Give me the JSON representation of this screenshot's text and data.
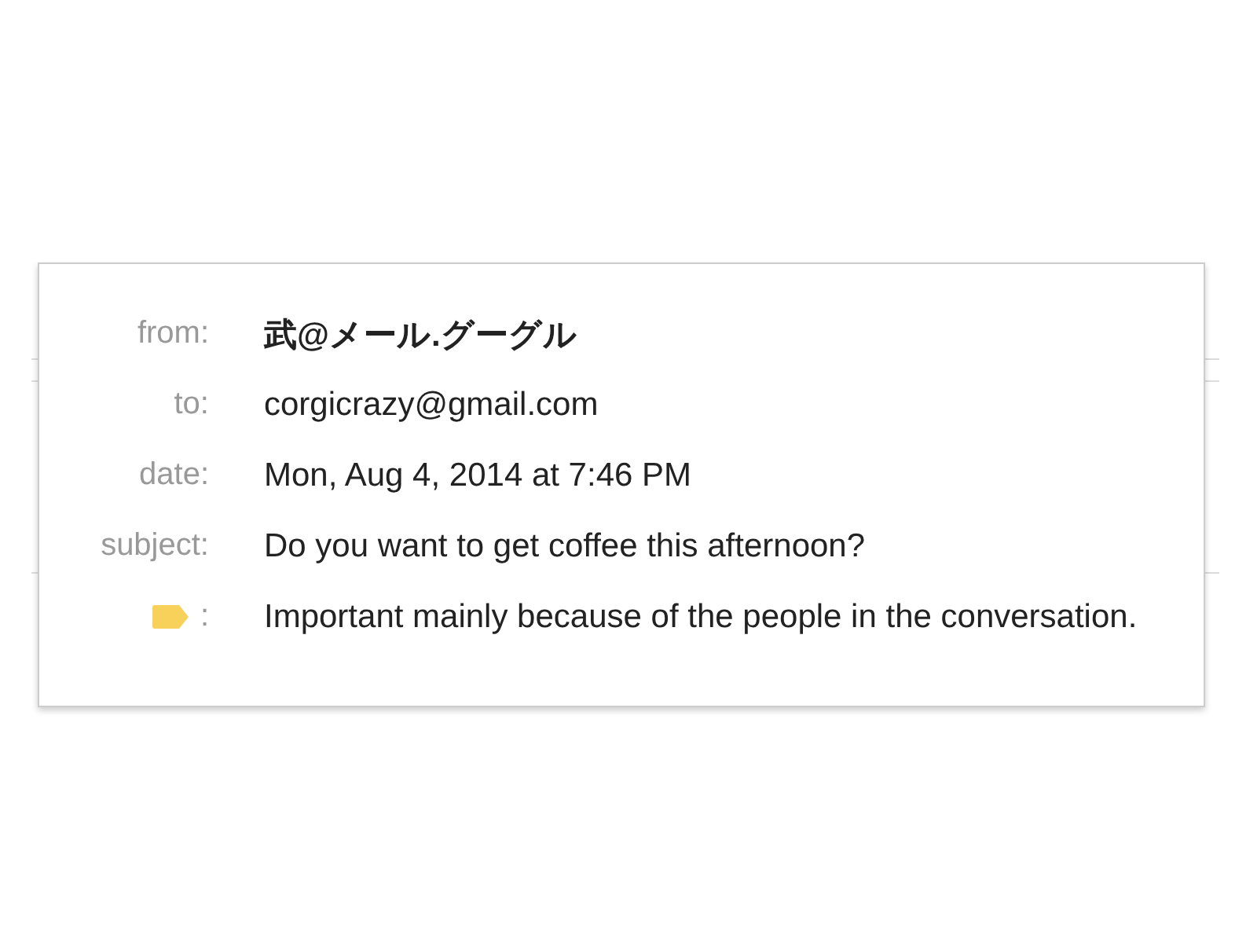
{
  "details_popup": {
    "rows": [
      {
        "kind": "sender",
        "label": "from:",
        "value": "武@メール.グーグル"
      },
      {
        "kind": "field",
        "label": "to:",
        "value": "corgicrazy@gmail.com"
      },
      {
        "kind": "field",
        "label": "date:",
        "value": "Mon, Aug 4, 2014 at 7:46 PM"
      },
      {
        "kind": "field",
        "label": "subject:",
        "value": "Do you want to get coffee this afternoon?"
      },
      {
        "kind": "importance",
        "label": ":",
        "value": "Important mainly because of the people in the conversation."
      }
    ]
  }
}
